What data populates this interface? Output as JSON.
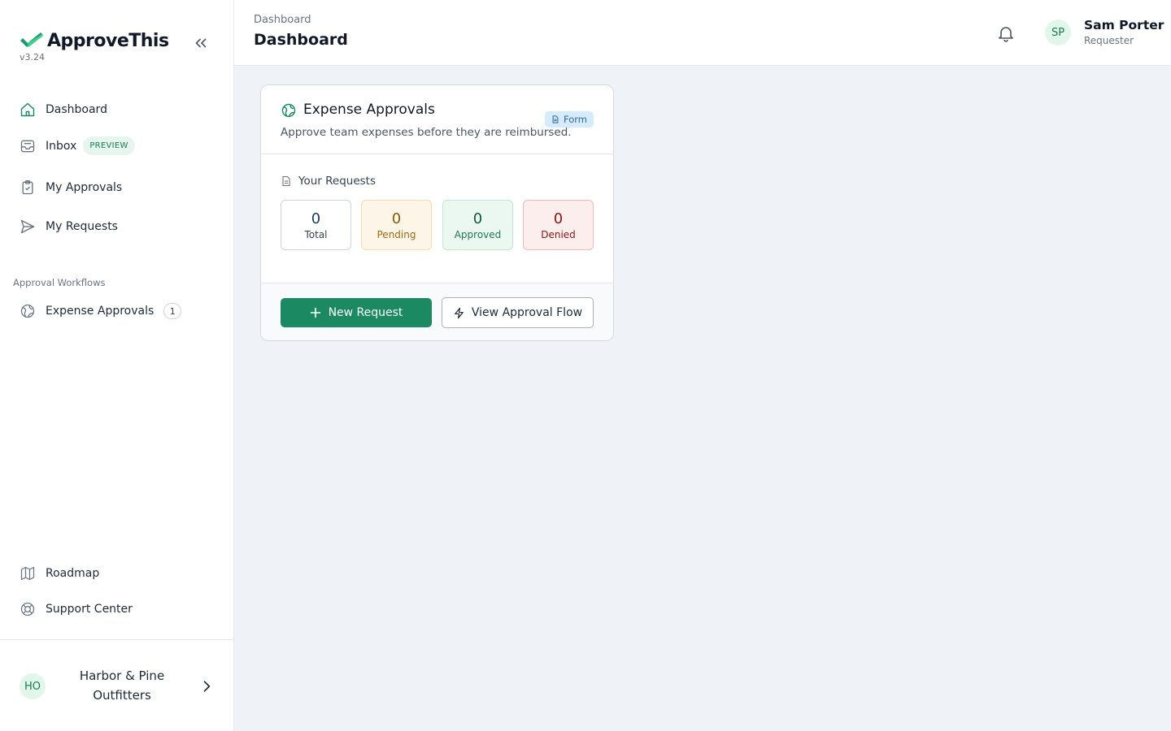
{
  "app": {
    "name": "ApproveThis",
    "version": "v3.24"
  },
  "sidebar": {
    "items": [
      {
        "label": "Dashboard",
        "icon": "home-icon"
      },
      {
        "label": "Inbox",
        "icon": "inbox-icon",
        "badge": "PREVIEW"
      },
      {
        "label": "My Approvals",
        "icon": "clipboard-check-icon"
      },
      {
        "label": "My Requests",
        "icon": "send-icon"
      }
    ],
    "workflows_label": "Approval Workflows",
    "workflows": [
      {
        "label": "Expense Approvals",
        "icon": "globe-icon",
        "count": "1"
      }
    ],
    "bottom_items": [
      {
        "label": "Roadmap",
        "icon": "map-icon"
      },
      {
        "label": "Support Center",
        "icon": "lifebuoy-icon"
      }
    ],
    "org": {
      "initials": "HO",
      "name": "Harbor & Pine Outfitters"
    }
  },
  "header": {
    "breadcrumb": "Dashboard",
    "title": "Dashboard",
    "user": {
      "initials": "SP",
      "name": "Sam Porter",
      "role": "Requester"
    }
  },
  "card": {
    "title": "Expense Approvals",
    "description": "Approve team expenses before they are reimbursed.",
    "badge": "Form",
    "requests_label": "Your Requests",
    "stats": {
      "total": {
        "value": "0",
        "label": "Total"
      },
      "pending": {
        "value": "0",
        "label": "Pending"
      },
      "approved": {
        "value": "0",
        "label": "Approved"
      },
      "denied": {
        "value": "0",
        "label": "Denied"
      }
    },
    "primary_button": "New Request",
    "secondary_button": "View Approval Flow"
  },
  "colors": {
    "accent": "#1b8a62",
    "brand_green": "#22c55e",
    "background": "#eff2f7"
  }
}
